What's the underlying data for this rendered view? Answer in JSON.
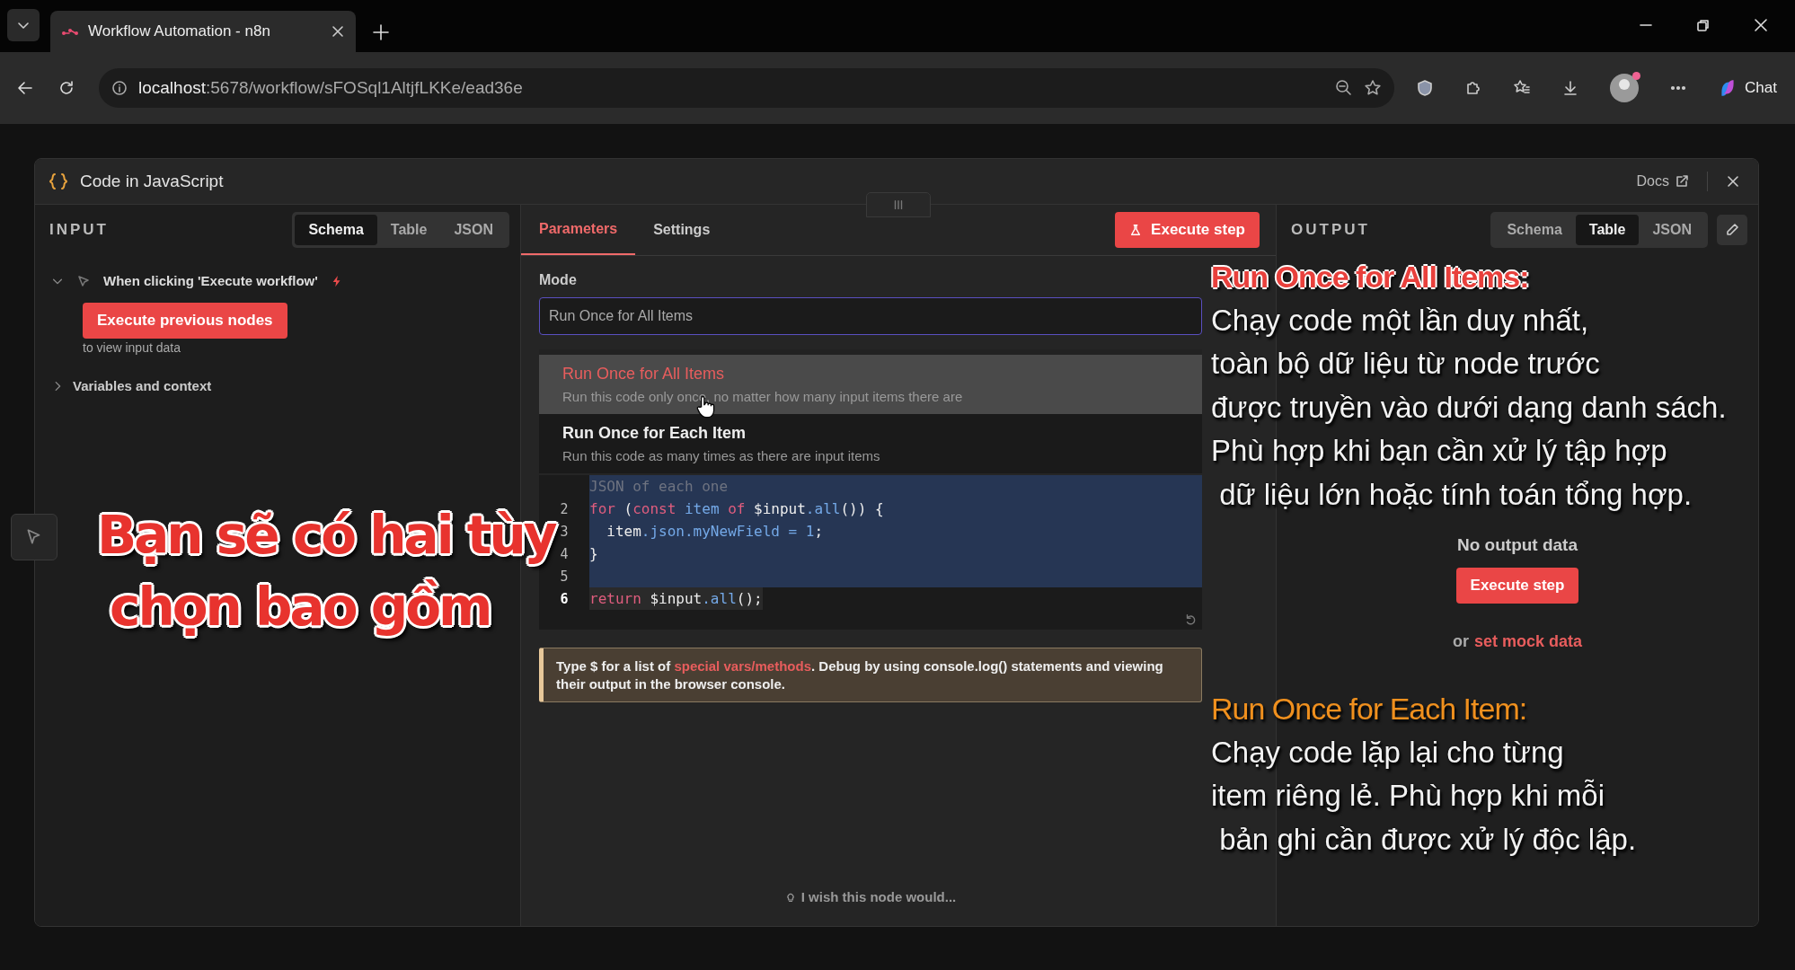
{
  "browser": {
    "tabs": [
      {
        "title": "Workflow Automation - n8n",
        "selected": true
      }
    ],
    "url": {
      "host": "localhost",
      "path": ":5678/workflow/sFOSql1AltjfLKKe/ead36e"
    },
    "chat": "Chat"
  },
  "modal": {
    "title": "Code in JavaScript",
    "docs": "Docs",
    "input": {
      "heading": "INPUT",
      "views": [
        {
          "label": "Schema",
          "selected": true
        },
        {
          "label": "Table",
          "selected": false
        },
        {
          "label": "JSON",
          "selected": false
        }
      ],
      "trigger": {
        "label": "When clicking 'Execute workflow'",
        "expanded": true
      },
      "button": "Execute previous nodes",
      "hint": "to view input data",
      "variables": {
        "label": "Variables and context",
        "expanded": false
      }
    },
    "parameters": {
      "tabs": [
        {
          "label": "Parameters",
          "selected": true
        },
        {
          "label": "Settings",
          "selected": false
        }
      ],
      "execute": "Execute step",
      "mode_label": "Mode",
      "mode_value": "Run Once for All Items",
      "options": [
        {
          "title": "Run Once for All Items",
          "description": "Run this code only once, no matter how many input items there are",
          "selected": true
        },
        {
          "title": "Run Once for Each Item",
          "description": "Run this code as many times as there are input items",
          "selected": false
        }
      ],
      "code": [
        {
          "selected": true,
          "active": false,
          "tokens": [
            {
              "kind": "comment",
              "text": "JSON of each one"
            }
          ]
        },
        {
          "number": "2",
          "selected": true,
          "active": false,
          "tokens": [
            {
              "kind": "keyword",
              "text": "for"
            },
            {
              "kind": "plain",
              "text": " ("
            },
            {
              "kind": "keyword",
              "text": "const"
            },
            {
              "kind": "name",
              "text": " item"
            },
            {
              "kind": "keyword",
              "text": " of"
            },
            {
              "kind": "plain",
              "text": " $input"
            },
            {
              "kind": "name",
              "text": ".all"
            },
            {
              "kind": "plain",
              "text": "()) {"
            }
          ]
        },
        {
          "number": "3",
          "selected": true,
          "active": false,
          "tokens": [
            {
              "kind": "plain",
              "text": "  item"
            },
            {
              "kind": "name",
              "text": ".json.myNewField = 1"
            },
            {
              "kind": "plain",
              "text": ";"
            }
          ]
        },
        {
          "number": "4",
          "selected": true,
          "active": false,
          "tokens": [
            {
              "kind": "plain",
              "text": "}"
            }
          ]
        },
        {
          "number": "5",
          "selected": true,
          "active": false
        },
        {
          "number": "6",
          "selected": false,
          "active": true,
          "tokens": [
            {
              "kind": "keyword",
              "text": "return"
            },
            {
              "kind": "plain",
              "text": " $input"
            },
            {
              "kind": "name",
              "text": ".all"
            },
            {
              "kind": "plain",
              "text": "();"
            }
          ]
        }
      ],
      "notice": {
        "before": "Type $ for a list of ",
        "link": "special vars/methods",
        "after": ". Debug by using console.log() statements and viewing their output in the browser console."
      },
      "feedback": "I wish this node would..."
    },
    "output": {
      "heading": "OUTPUT",
      "views": [
        {
          "label": "Schema",
          "selected": false
        },
        {
          "label": "Table",
          "selected": true
        },
        {
          "label": "JSON",
          "selected": false
        }
      ],
      "empty": "No output data",
      "button": "Execute step",
      "mock_prefix": "or",
      "mock_link": "set mock data"
    }
  },
  "captions": [
    {
      "kind": "headline",
      "lines": [
        "Bạn sẽ có hai tùy",
        "chọn bao gồm"
      ]
    },
    {
      "kind": "note",
      "title": "Run Once for All Items:",
      "color": "#e8403c",
      "lines": [
        "Chạy code một lần duy nhất,",
        "toàn bộ dữ liệu từ node trước",
        "được truyền vào dưới dạng danh sách.",
        "Phù hợp khi bạn cần xử lý tập hợp",
        " dữ liệu lớn hoặc tính toán tổng hợp."
      ]
    },
    {
      "kind": "note",
      "title": "Run Once for Each Item:",
      "color": "#f0901e",
      "lines": [
        "Chạy code lặp lại cho từng",
        "item riêng lẻ. Phù hợp khi mỗi",
        " bản ghi cần được xử lý độc lập."
      ]
    }
  ]
}
